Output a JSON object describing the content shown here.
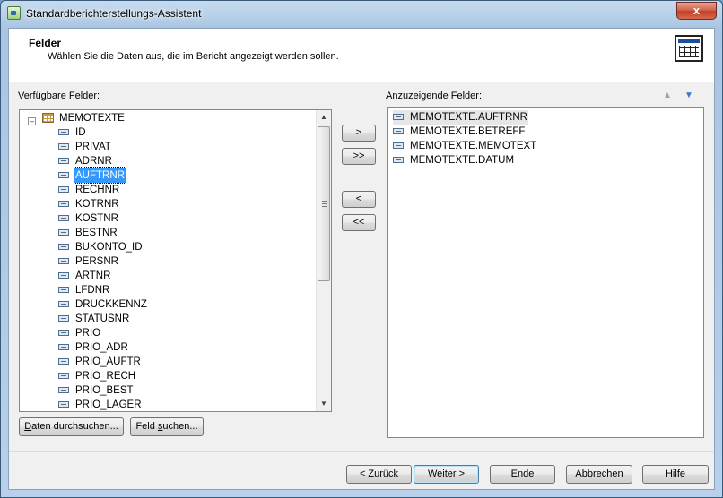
{
  "window": {
    "title": "Standardberichterstellungs-Assistent",
    "close_label": "x"
  },
  "header": {
    "title": "Felder",
    "subtitle": "Wählen Sie die Daten aus, die im Bericht angezeigt werden sollen."
  },
  "available": {
    "label": "Verfügbare Felder:",
    "table": "MEMOTEXTE",
    "fields": [
      "ID",
      "PRIVAT",
      "ADRNR",
      "AUFTRNR",
      "RECHNR",
      "KOTRNR",
      "KOSTNR",
      "BESTNR",
      "BUKONTO_ID",
      "PERSNR",
      "ARTNR",
      "LFDNR",
      "DRUCKKENNZ",
      "STATUSNR",
      "PRIO",
      "PRIO_ADR",
      "PRIO_AUFTR",
      "PRIO_RECH",
      "PRIO_BEST",
      "PRIO_LAGER"
    ],
    "selected_field": "AUFTRNR"
  },
  "display": {
    "label": "Anzuzeigende Felder:",
    "fields": [
      "MEMOTEXTE.AUFTRNR",
      "MEMOTEXTE.BETREFF",
      "MEMOTEXTE.MEMOTEXT",
      "MEMOTEXTE.DATUM"
    ]
  },
  "move_buttons": {
    "add": ">",
    "add_all": ">>",
    "remove": "<",
    "remove_all": "<<"
  },
  "left_buttons": {
    "browse": "Daten durchsuchen...",
    "find": "Feld suchen..."
  },
  "footer": {
    "back": "< Zurück",
    "next": "Weiter >",
    "finish": "Ende",
    "cancel": "Abbrechen",
    "help": "Hilfe"
  }
}
